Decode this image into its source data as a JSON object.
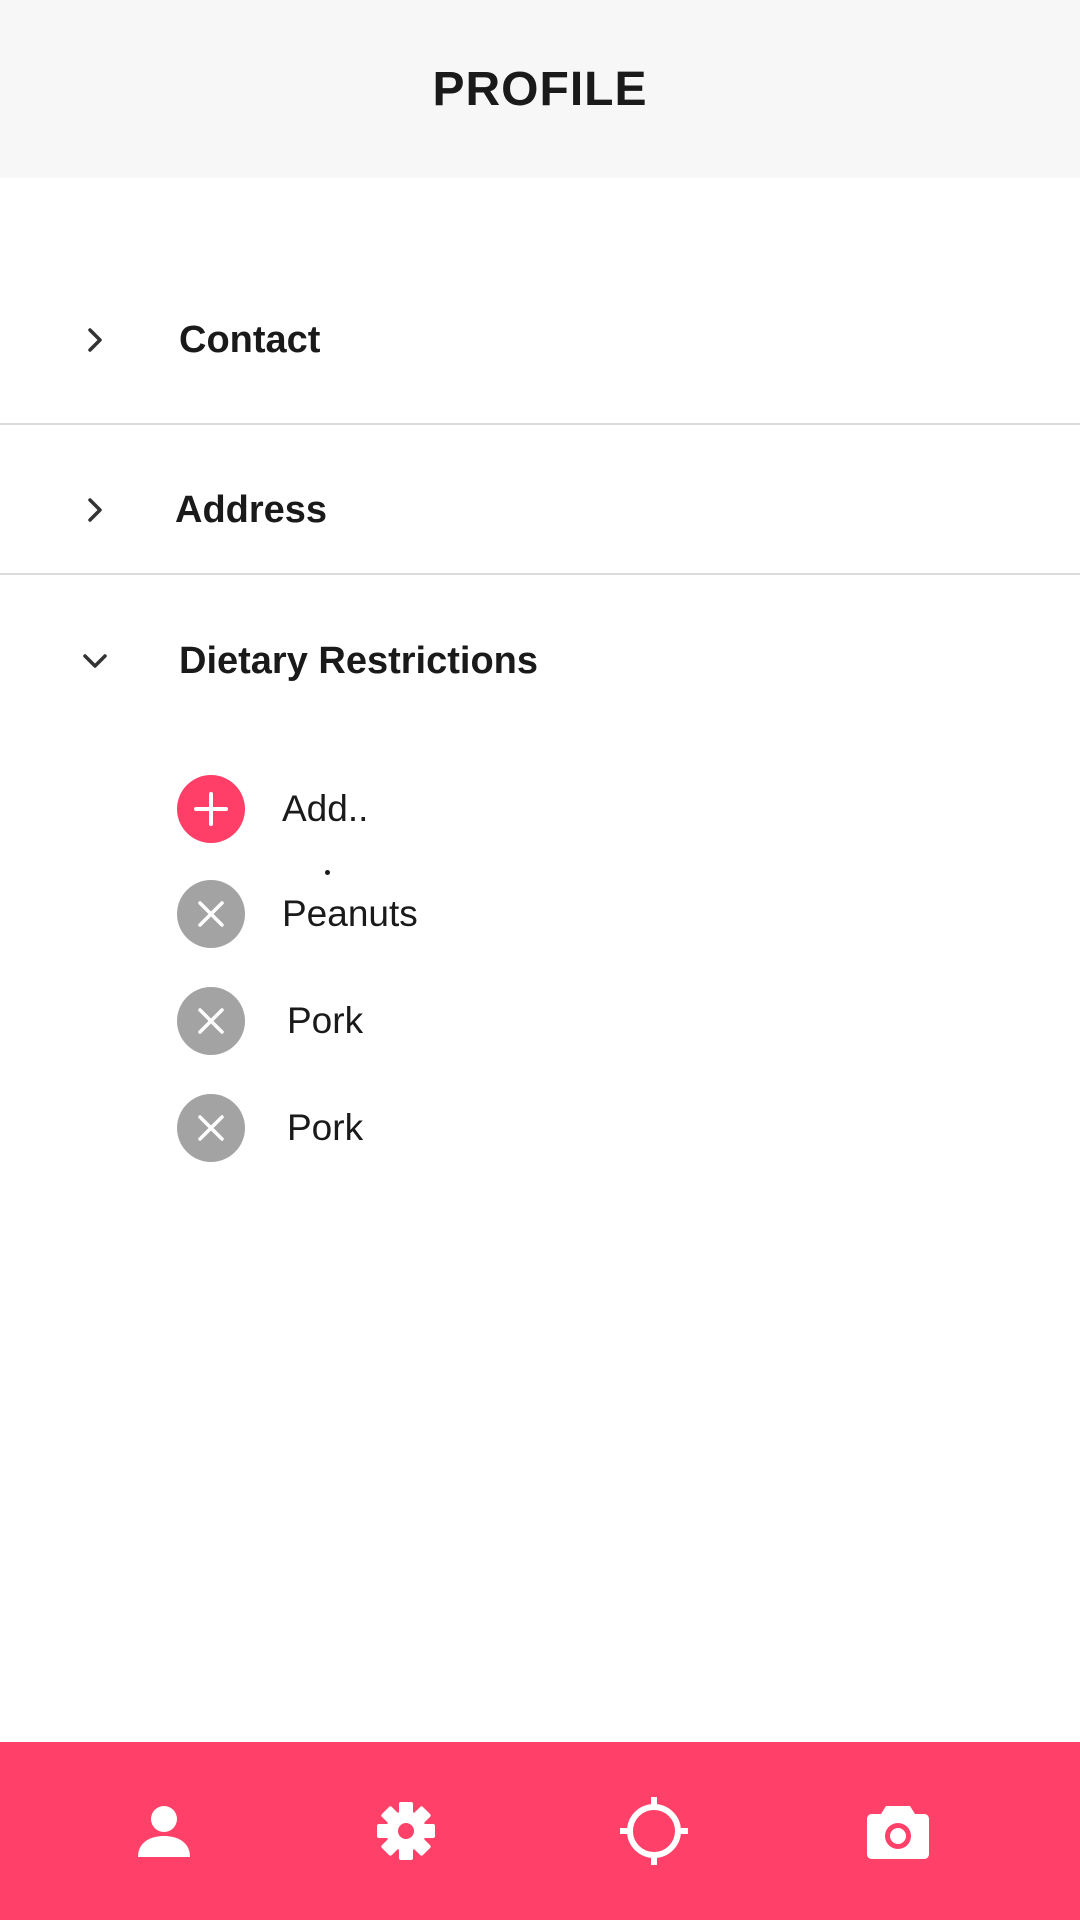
{
  "header": {
    "title": "PROFILE"
  },
  "sections": {
    "contact": {
      "label": "Contact",
      "state": "collapsed",
      "icon": "chevron-right-icon"
    },
    "address": {
      "label": "Address",
      "state": "collapsed",
      "icon": "chevron-right-icon"
    },
    "dietary": {
      "label": "Dietary Restrictions",
      "state": "expanded",
      "icon": "chevron-down-icon"
    }
  },
  "dietary_items": {
    "add": {
      "label": "Add..",
      "icon": "plus-icon"
    },
    "items": [
      {
        "label": "Peanuts",
        "icon": "close-icon"
      },
      {
        "label": "Pork",
        "icon": "close-icon"
      },
      {
        "label": "Pork",
        "icon": "close-icon"
      }
    ]
  },
  "bottom_nav": {
    "items": [
      {
        "icon": "person-icon"
      },
      {
        "icon": "gear-icon"
      },
      {
        "icon": "crosshair-icon"
      },
      {
        "icon": "camera-icon"
      }
    ]
  },
  "colors": {
    "accent": "#ff4068",
    "header_bg": "#f7f7f7",
    "remove_button": "#a3a3a3",
    "divider": "#dcdcdc",
    "text": "#1a1a1a"
  }
}
